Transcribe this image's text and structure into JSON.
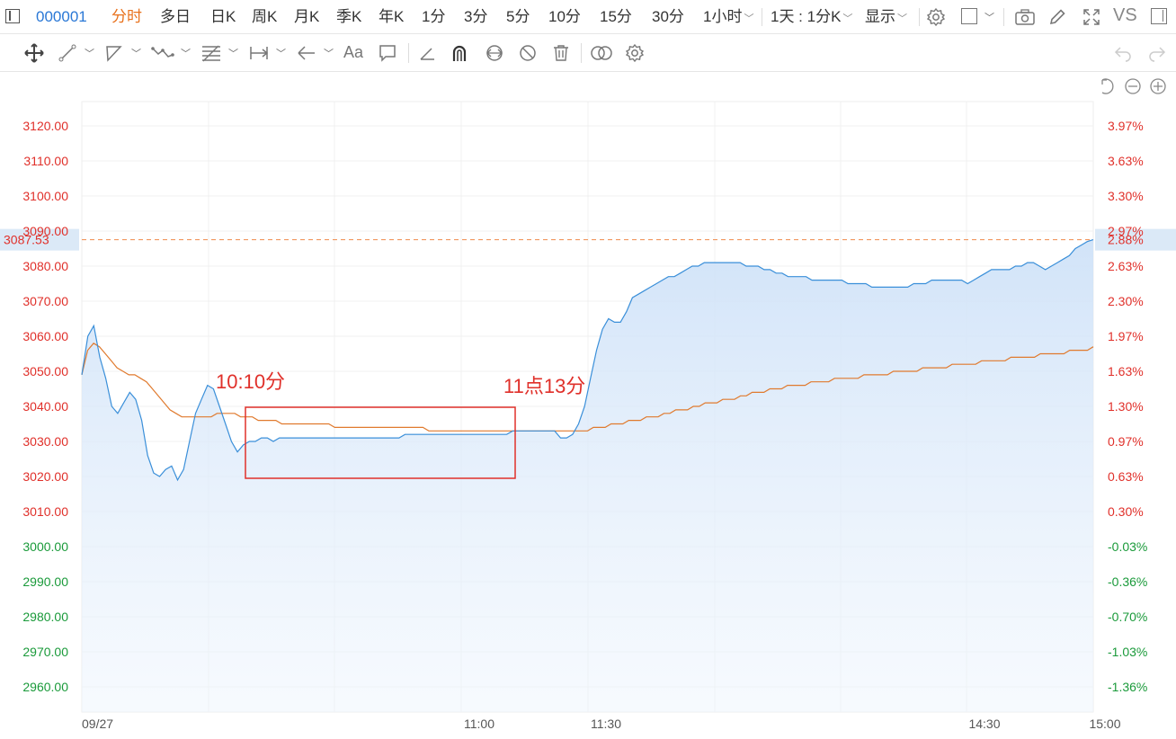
{
  "toolbar": {
    "code": "000001",
    "periods": [
      {
        "label": "分时",
        "active": true
      },
      {
        "label": "多日",
        "active": false
      },
      {
        "label": "日K",
        "active": false
      },
      {
        "label": "周K",
        "active": false
      },
      {
        "label": "月K",
        "active": false
      },
      {
        "label": "季K",
        "active": false
      },
      {
        "label": "年K",
        "active": false
      },
      {
        "label": "1分",
        "active": false
      },
      {
        "label": "3分",
        "active": false
      },
      {
        "label": "5分",
        "active": false
      },
      {
        "label": "10分",
        "active": false
      },
      {
        "label": "15分",
        "active": false
      },
      {
        "label": "30分",
        "active": false
      }
    ],
    "hour_label": "1小时",
    "range_label": "1天 : 1分K",
    "display_label": "显示",
    "vs_label": "VS",
    "text_tool_label": "Aa"
  },
  "colors": {
    "price_line": "#3a8fd9",
    "avg_line": "#e07a2e",
    "up": "#e0302a",
    "down": "#1a9a3a",
    "annotation": "#e0302a",
    "ref_line": "#f08a4b"
  },
  "chart_data": {
    "type": "line",
    "x_ticks": [
      "09/27",
      "11:00",
      "11:30",
      "14:30",
      "15:00"
    ],
    "y_left_ticks": [
      "3120.00",
      "3110.00",
      "3100.00",
      "3090.00",
      "3080.00",
      "3070.00",
      "3060.00",
      "3050.00",
      "3040.00",
      "3030.00",
      "3020.00",
      "3010.00",
      "3000.00",
      "2990.00",
      "2980.00",
      "2970.00",
      "2960.00"
    ],
    "y_right_ticks": [
      "3.97%",
      "3.63%",
      "3.30%",
      "2.97%",
      "2.63%",
      "2.30%",
      "1.97%",
      "1.63%",
      "1.30%",
      "0.97%",
      "0.63%",
      "0.30%",
      "-0.03%",
      "-0.36%",
      "-0.70%",
      "-1.03%",
      "-1.36%"
    ],
    "ylim": [
      2954,
      3132
    ],
    "current_price": "3087.53",
    "current_pct": "2.88%",
    "series": [
      {
        "values": [
          3049,
          3060,
          3063,
          3054,
          3048,
          3040,
          3038,
          3041,
          3044,
          3042,
          3036,
          3026,
          3021,
          3020,
          3022,
          3023,
          3019,
          3022,
          3030,
          3038,
          3042,
          3046,
          3045,
          3040,
          3035,
          3030,
          3027,
          3029,
          3030,
          3030,
          3031,
          3031,
          3030,
          3031,
          3031,
          3031,
          3031,
          3031,
          3031,
          3031,
          3031,
          3031,
          3031,
          3031,
          3031,
          3031,
          3031,
          3031,
          3031,
          3031,
          3031,
          3031,
          3031,
          3031,
          3032,
          3032,
          3032,
          3032,
          3032,
          3032,
          3032,
          3032,
          3032,
          3032,
          3032,
          3032,
          3032,
          3032,
          3032,
          3032,
          3032,
          3032,
          3033,
          3033,
          3033,
          3033,
          3033,
          3033,
          3033,
          3033,
          3031,
          3031,
          3032,
          3035,
          3040,
          3048,
          3056,
          3062,
          3065,
          3064,
          3064,
          3067,
          3071,
          3072,
          3073,
          3074,
          3075,
          3076,
          3077,
          3077,
          3078,
          3079,
          3080,
          3080,
          3081,
          3081,
          3081,
          3081,
          3081,
          3081,
          3081,
          3080,
          3080,
          3080,
          3079,
          3079,
          3078,
          3078,
          3077,
          3077,
          3077,
          3077,
          3076,
          3076,
          3076,
          3076,
          3076,
          3076,
          3075,
          3075,
          3075,
          3075,
          3074,
          3074,
          3074,
          3074,
          3074,
          3074,
          3074,
          3075,
          3075,
          3075,
          3076,
          3076,
          3076,
          3076,
          3076,
          3076,
          3075,
          3076,
          3077,
          3078,
          3079,
          3079,
          3079,
          3079,
          3080,
          3080,
          3081,
          3081,
          3080,
          3079,
          3080,
          3081,
          3082,
          3083,
          3085,
          3086,
          3087,
          3087.53
        ]
      },
      {
        "values": [
          3049,
          3056,
          3058,
          3057,
          3055,
          3053,
          3051,
          3050,
          3049,
          3049,
          3048,
          3047,
          3045,
          3043,
          3041,
          3039,
          3038,
          3037,
          3037,
          3037,
          3037,
          3037,
          3037,
          3038,
          3038,
          3038,
          3038,
          3037,
          3037,
          3037,
          3036,
          3036,
          3036,
          3036,
          3035,
          3035,
          3035,
          3035,
          3035,
          3035,
          3035,
          3035,
          3035,
          3034,
          3034,
          3034,
          3034,
          3034,
          3034,
          3034,
          3034,
          3034,
          3034,
          3034,
          3034,
          3034,
          3034,
          3034,
          3034,
          3033,
          3033,
          3033,
          3033,
          3033,
          3033,
          3033,
          3033,
          3033,
          3033,
          3033,
          3033,
          3033,
          3033,
          3033,
          3033,
          3033,
          3033,
          3033,
          3033,
          3033,
          3033,
          3033,
          3033,
          3033,
          3033,
          3033,
          3033,
          3034,
          3034,
          3034,
          3035,
          3035,
          3035,
          3036,
          3036,
          3036,
          3037,
          3037,
          3037,
          3038,
          3038,
          3039,
          3039,
          3039,
          3040,
          3040,
          3041,
          3041,
          3041,
          3042,
          3042,
          3042,
          3043,
          3043,
          3044,
          3044,
          3044,
          3045,
          3045,
          3045,
          3046,
          3046,
          3046,
          3046,
          3047,
          3047,
          3047,
          3047,
          3048,
          3048,
          3048,
          3048,
          3048,
          3049,
          3049,
          3049,
          3049,
          3049,
          3050,
          3050,
          3050,
          3050,
          3050,
          3051,
          3051,
          3051,
          3051,
          3051,
          3052,
          3052,
          3052,
          3052,
          3052,
          3053,
          3053,
          3053,
          3053,
          3053,
          3054,
          3054,
          3054,
          3054,
          3054,
          3055,
          3055,
          3055,
          3055,
          3055,
          3056,
          3056,
          3056,
          3056,
          3057
        ]
      }
    ],
    "annotations": [
      {
        "label": "10:10分"
      },
      {
        "label": "11点13分"
      }
    ],
    "grid": true
  }
}
